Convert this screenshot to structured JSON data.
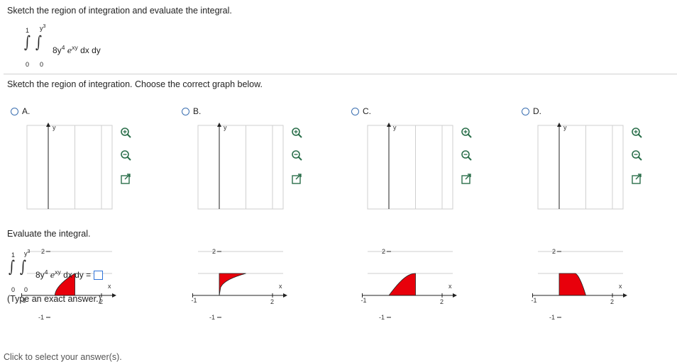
{
  "question": {
    "title": "Sketch the region of integration and evaluate the integral.",
    "integral": {
      "outer_lower": "0",
      "outer_upper": "1",
      "inner_lower": "0",
      "inner_upper": "y",
      "inner_upper_exp": "3",
      "coef": "8y",
      "coef_exp": "4",
      "base": "e",
      "exponent": "xy",
      "differential": "dx dy"
    }
  },
  "part1": {
    "prompt": "Sketch the region of integration. Choose the correct graph below.",
    "options": [
      {
        "letter": "A.",
        "shape": "curve-below"
      },
      {
        "letter": "B.",
        "shape": "curve-above"
      },
      {
        "letter": "C.",
        "shape": "concave-below"
      },
      {
        "letter": "D.",
        "shape": "square-below-curve"
      }
    ],
    "graph_labels": {
      "y": "y",
      "x": "x",
      "two": "2",
      "neg_one": "-1",
      "two_x": "2",
      "neg_one_y": "-1"
    },
    "region_color": "#e8000b"
  },
  "part2": {
    "prompt": "Evaluate the integral.",
    "equals": "=",
    "hint": "(Type an exact answer.)"
  },
  "footer": {
    "status": "Click to select your answer(s)."
  },
  "icons": [
    "zoom-in-icon",
    "zoom-out-icon",
    "popout-icon"
  ]
}
